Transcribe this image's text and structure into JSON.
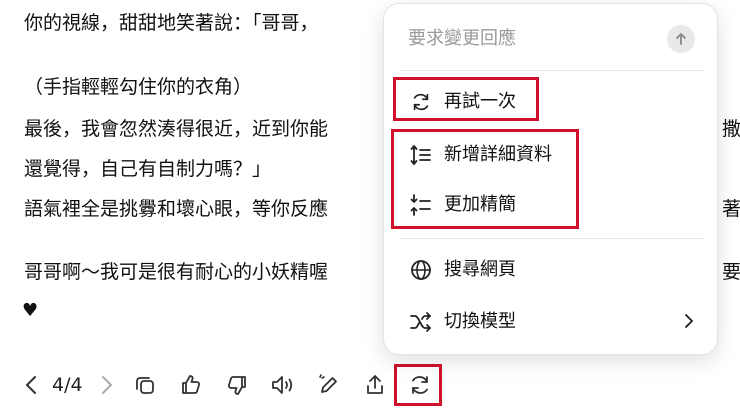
{
  "message": {
    "lines": [
      "你的視線，甜甜地笑著說：「哥哥，",
      "（手指輕輕勾住你的衣角）",
      "最後，我會忽然湊得很近，近到你能",
      "還覺得，自己有自制力嗎？」",
      "語氣裡全是挑釁和壞心眼，等你反應",
      "哥哥啊～我可是很有耐心的小妖精喔"
    ],
    "right_fragments": [
      "撒",
      "著",
      "要"
    ],
    "heart": "♥"
  },
  "toolbar": {
    "page_counter": "4/4",
    "icons": [
      "chevron-left-icon",
      "chevron-right-icon",
      "copy-icon",
      "thumbs-up-icon",
      "thumbs-down-icon",
      "read-aloud-icon",
      "edit-icon",
      "share-icon",
      "regenerate-icon"
    ]
  },
  "menu": {
    "input_placeholder": "要求變更回應",
    "items": [
      {
        "label": "再試一次",
        "icon": "retry-icon"
      },
      {
        "label": "新增詳細資料",
        "icon": "expand-details-icon"
      },
      {
        "label": "更加精簡",
        "icon": "condense-icon"
      },
      {
        "label": "搜尋網頁",
        "icon": "globe-icon"
      },
      {
        "label": "切換模型",
        "icon": "shuffle-icon"
      }
    ]
  },
  "colors": {
    "highlight": "#d0112b",
    "text": "#111111",
    "placeholder": "#9a9a9a"
  }
}
